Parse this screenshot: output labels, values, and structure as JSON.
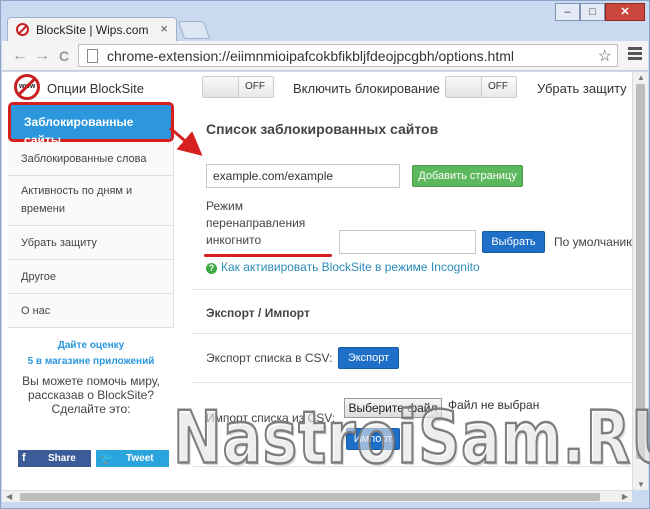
{
  "browser": {
    "tab_title": "BlockSite | Wips.com",
    "tab_close": "×",
    "window_buttons": [
      "–",
      "□",
      "✕"
    ],
    "back": "←",
    "forward": "→",
    "reload": "C",
    "url": "chrome-extension://eiimnmioipafcokbfikbljfdeojpcgbh/options.html",
    "star": "☆"
  },
  "header": {
    "logo_text": "www",
    "app_title": "Опции BlockSite",
    "toggle1": {
      "state": "OFF",
      "label": "Включить блокирование"
    },
    "toggle2": {
      "state": "OFF",
      "label": "Убрать защиту"
    }
  },
  "sidebar": {
    "items": [
      {
        "label": "Заблокированные сайты",
        "active": true
      },
      {
        "label": "Заблокированные слова"
      },
      {
        "label": "Активность по дням и времени"
      },
      {
        "label": "Убрать защиту"
      },
      {
        "label": "Другое"
      },
      {
        "label": "О нас"
      }
    ],
    "promo_link_line1": "Дайте оценку",
    "promo_link_line2": "5 в магазине приложений",
    "promo_text": "Вы можете помочь миру, рассказав о BlockSite? Сделайте это:",
    "share_label": "Share",
    "tweet_label": "Tweet",
    "fb_icon": "f",
    "tw_icon": "🐦"
  },
  "main": {
    "title": "Список заблокированных сайтов",
    "site_input_value": "example.com/example",
    "add_button": "Добавить страницу",
    "redirect_label": "Режим перенаправления инкогнито",
    "redirect_input_value": "",
    "choose_button": "Выбрать",
    "default_label": "По умолчанию",
    "help_icon": "?",
    "help_link": "Как активировать BlockSite в режиме Incognito",
    "export_import_heading": "Экспорт / Импорт",
    "export_label": "Экспорт списка в CSV:",
    "export_button": "Экспорт",
    "import_label": "Импорт списка из CSV:",
    "file_button": "Выберите файл",
    "file_status": "Файл не выбран",
    "import_button": "Импорт"
  },
  "watermark": "NastroiSam.RU",
  "colors": {
    "accent_blue": "#2c97dd",
    "annotation_red": "#d62020",
    "button_green": "#5cb85c",
    "button_blue": "#1d6fc8"
  }
}
